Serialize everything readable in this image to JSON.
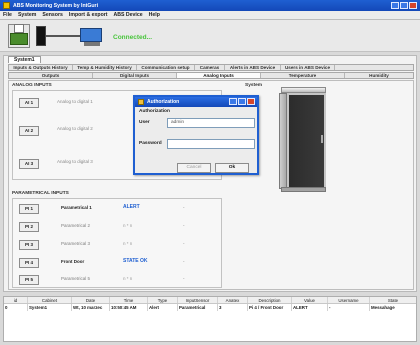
{
  "window": {
    "title": "ABS Monitoring System by IntGuri"
  },
  "menu": {
    "items": [
      "File",
      "System",
      "Sensors",
      "Import & export",
      "ABS Device",
      "Help"
    ]
  },
  "toolbar": {
    "status_text": "Connected..."
  },
  "system_tab": {
    "label": "System1"
  },
  "tabs_row1": [
    "Inputs & Outputs History",
    "Temp & Humidity History",
    "Communication setup",
    "Cameras",
    "Alerts in ABS Device",
    "Users in ABS Device"
  ],
  "tabs_row2": [
    "Outputs",
    "Digital Inputs",
    "Analog Inputs",
    "Temperature",
    "Humidity"
  ],
  "analog_inputs": {
    "title": "ANALOG INPUTS",
    "items": [
      {
        "button": "AI 1",
        "label": "Analog to digital 1"
      },
      {
        "button": "AI 2",
        "label": "Analog to digital 2"
      },
      {
        "button": "AI 3",
        "label": "Analog to digital 3"
      }
    ]
  },
  "system_panel": {
    "title": "System"
  },
  "parametrical_inputs": {
    "title": "PARAMETRICAL INPUTS",
    "items": [
      {
        "button": "PI 1",
        "name": "Parametrical 1",
        "status": "ALERT",
        "value": "-"
      },
      {
        "button": "PI 2",
        "name": "Parametrical 2",
        "status": "n * n",
        "value": "-"
      },
      {
        "button": "PI 3",
        "name": "Parametrical 3",
        "status": "n * n",
        "value": "-"
      },
      {
        "button": "PI 4",
        "name": "Front Door",
        "status": "STATE OK",
        "value": "-"
      },
      {
        "button": "PI 5",
        "name": "Parametrical 5",
        "status": "n * n",
        "value": "-"
      }
    ]
  },
  "auth_dialog": {
    "title": "Authorization",
    "heading": "Authorization",
    "user_label": "User",
    "user_value": "admin",
    "password_label": "Password",
    "password_value": "",
    "cancel_label": "Cancel",
    "ok_label": "Ok"
  },
  "log_table": {
    "columns": [
      "id",
      "Cabinet",
      "Date",
      "Time",
      "Type",
      "InputSensor",
      "Anatex",
      "Description",
      "Value",
      "Username",
      "State"
    ],
    "rows": [
      [
        "0",
        "System1",
        "Wt, 10 marzec",
        "10:50:45 AM",
        "Alert",
        "Parametrical",
        "3",
        "Pi 4 / Front Door",
        "ALERT",
        "-",
        "Messahage"
      ]
    ]
  },
  "colors": {
    "title_blue": "#1f5fd1",
    "connected_green": "#49c53c",
    "alert_blue": "#1f5fd1"
  }
}
